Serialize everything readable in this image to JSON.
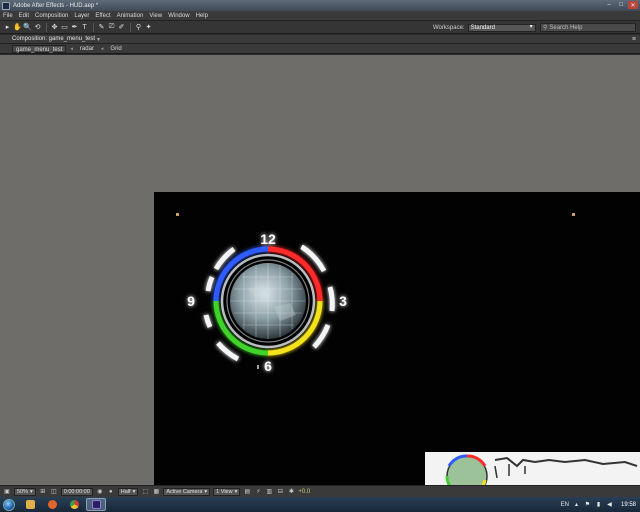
{
  "window": {
    "title": "Adobe After Effects - HUD.aep *",
    "minimize": "–",
    "maximize": "□",
    "close": "✕"
  },
  "menu": [
    "File",
    "Edit",
    "Composition",
    "Layer",
    "Effect",
    "Animation",
    "View",
    "Window",
    "Help"
  ],
  "toolbar": {
    "tools": [
      "▸",
      "✋",
      "🔍",
      "⟲",
      "✥",
      "▭",
      "✒",
      "T",
      "✎",
      "⎚",
      "✐",
      "⚲",
      "✦"
    ],
    "workspace_label": "Workspace:",
    "workspace_value": "Standard",
    "search_placeholder": "Search Help"
  },
  "composition": {
    "tab_label": "Composition: game_menu_test",
    "breadcrumbs": [
      "game_menu_test",
      "radar",
      "Grid"
    ]
  },
  "hud": {
    "labels": {
      "top": "12",
      "right": "3",
      "bottom": "6",
      "left": "9"
    },
    "colors": {
      "blue": "#2f5bff",
      "red": "#ff2a2a",
      "yellow": "#f3e21b",
      "green": "#3fd12a",
      "ring": "#e9edf2",
      "globe": "#9fb0b6"
    }
  },
  "viewer_controls": {
    "magnification": "50%",
    "timecode": "0:00:00:00",
    "resolution": "Half",
    "camera": "Active Camera",
    "views": "1 View",
    "exposure": "+0.0"
  },
  "taskbar": {
    "language": "EN",
    "time": "19:58",
    "apps": [
      {
        "name": "explorer",
        "color": "#e0b14a"
      },
      {
        "name": "firefox",
        "color": "#e0652a"
      },
      {
        "name": "chrome",
        "color": "#3aa04a"
      },
      {
        "name": "after-effects",
        "color": "#8f7fd8"
      }
    ]
  }
}
